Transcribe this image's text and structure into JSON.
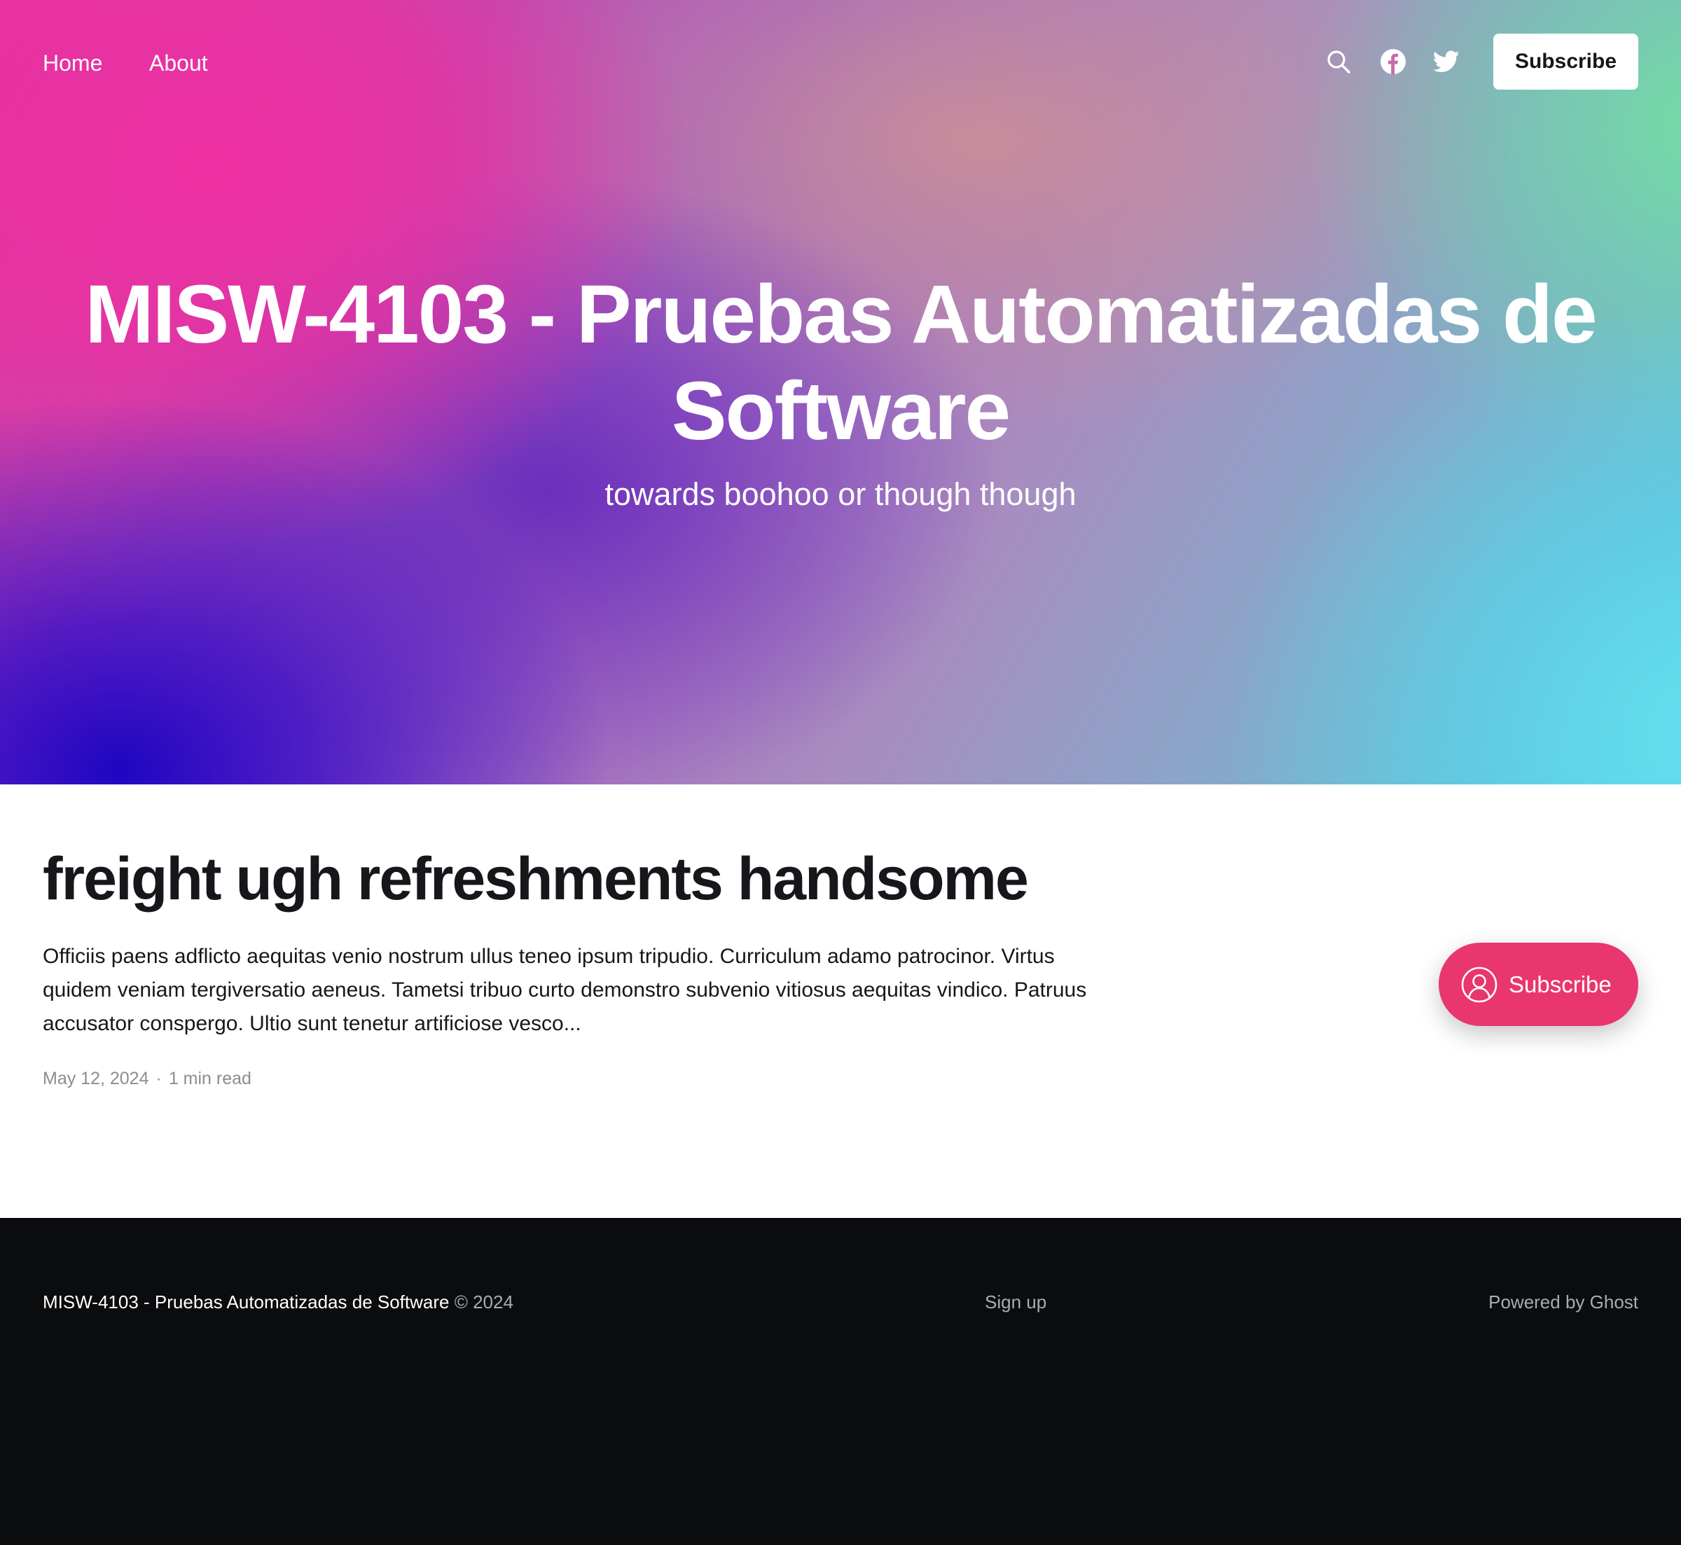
{
  "nav": {
    "links": [
      {
        "label": "Home"
      },
      {
        "label": "About"
      }
    ],
    "icons": [
      "search-icon",
      "facebook-icon",
      "twitter-icon"
    ],
    "subscribe_label": "Subscribe"
  },
  "hero": {
    "title": "MISW-4103 - Pruebas Automatizadas de Software",
    "subtitle": "towards boohoo or though though"
  },
  "post": {
    "title": "freight ugh refreshments handsome",
    "excerpt": "Officiis paens adflicto aequitas venio nostrum ullus teneo ipsum tripudio. Curriculum adamo patrocinor. Virtus quidem veniam tergiversatio aeneus. Tametsi tribuo curto demonstro subvenio vitiosus aequitas vindico. Patruus accusator conspergo. Ultio sunt tenetur artificiose vesco...",
    "date": "May 12, 2024",
    "separator": "·",
    "read_time": "1 min read"
  },
  "portal": {
    "label": "Subscribe",
    "icon": "user-circle-icon"
  },
  "footer": {
    "site_name": "MISW-4103 - Pruebas Automatizadas de Software",
    "copyright": "© 2024",
    "signup": "Sign up",
    "powered_by": "Powered by Ghost"
  },
  "colors": {
    "portal_accent": "#e9366f",
    "footer_bg": "#0b0c0e",
    "text_dark": "#15171a",
    "meta_gray": "#8a8d92"
  }
}
